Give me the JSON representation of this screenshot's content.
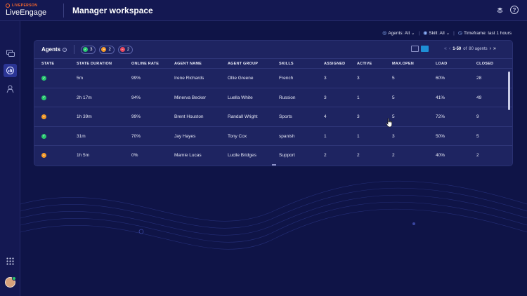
{
  "app": {
    "logo_small": "LIVEPERSON",
    "logo_main": "LiveEngage",
    "title": "Manager workspace"
  },
  "topbar_icons": [
    "layers-icon",
    "help-icon"
  ],
  "sidebar": {
    "items": [
      {
        "name": "messaging-icon",
        "active": false
      },
      {
        "name": "analytics-icon",
        "active": true
      },
      {
        "name": "agent-icon",
        "active": false
      }
    ],
    "apps_icon": "grid-icon",
    "avatar_status": "online"
  },
  "filters": {
    "agents": "Agents: All",
    "skill": "Skill: All",
    "timeframe": "Timeframe: last 1 hours"
  },
  "panel": {
    "title": "Agents",
    "chips": [
      {
        "status": "online",
        "count": "3",
        "color": "#28c76f"
      },
      {
        "status": "away",
        "count": "2",
        "color": "#f39b2a"
      },
      {
        "status": "busy",
        "count": "2",
        "color": "#e84a5f"
      }
    ],
    "pager": {
      "range": "1-50",
      "of_text": "of",
      "total": "80 agents"
    }
  },
  "table": {
    "columns": [
      "STATE",
      "STATE DURATION",
      "ONLINE RATE",
      "AGENT NAME",
      "AGENT GROUP",
      "SKILLS",
      "ASSIGNED",
      "ACTIVE",
      "MAX.OPEN",
      "LOAD",
      "CLOSED"
    ],
    "rows": [
      {
        "state": "online",
        "duration": "5m",
        "online_rate": "99%",
        "name": "Irene Richards",
        "group": "Ollie Greene",
        "skill": "French",
        "assigned": "3",
        "active": "3",
        "max_open": "5",
        "load": "60%",
        "closed": "28"
      },
      {
        "state": "online",
        "duration": "2h 17m",
        "online_rate": "94%",
        "name": "Minerva Becker",
        "group": "Luella White",
        "skill": "Russion",
        "assigned": "3",
        "active": "1",
        "max_open": "5",
        "load": "41%",
        "closed": "49"
      },
      {
        "state": "away",
        "duration": "1h 39m",
        "online_rate": "99%",
        "name": "Brent Houston",
        "group": "Randall Wright",
        "skill": "Sports",
        "assigned": "4",
        "active": "3",
        "max_open": "5",
        "load": "72%",
        "closed": "9"
      },
      {
        "state": "online",
        "duration": "31m",
        "online_rate": "70%",
        "name": "Jay Hayes",
        "group": "Tony Cox",
        "skill": "spanish",
        "assigned": "1",
        "active": "1",
        "max_open": "3",
        "load": "50%",
        "closed": "5"
      },
      {
        "state": "away",
        "duration": "1h 5m",
        "online_rate": "0%",
        "name": "Mamie Lucas",
        "group": "Lucile Bridges",
        "skill": "Support",
        "assigned": "2",
        "active": "2",
        "max_open": "2",
        "load": "40%",
        "closed": "2"
      }
    ]
  },
  "colors": {
    "background": "#0f1447",
    "panel": "#1e2461",
    "accent": "#1e8fd6",
    "online": "#28c76f",
    "away": "#f39b2a",
    "busy": "#e84a5f"
  }
}
